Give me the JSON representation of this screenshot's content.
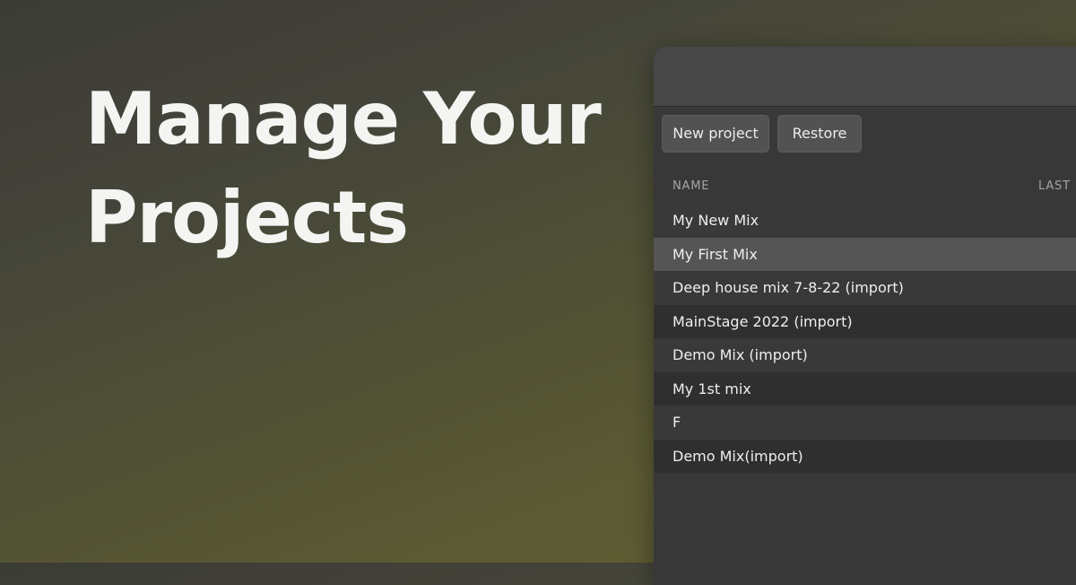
{
  "headline": {
    "line1": "Manage Your",
    "line2": "Projects"
  },
  "window": {
    "toolbar": {
      "new_project_label": "New project",
      "restore_label": "Restore"
    },
    "columns": {
      "name": "NAME",
      "last": "LAST"
    },
    "selected_index": 1,
    "projects": [
      "My New Mix",
      "My First Mix",
      "Deep house mix 7-8-22 (import)",
      "MainStage 2022 (import)",
      "Demo Mix (import)",
      "My 1st mix",
      "F",
      "Demo Mix(import)"
    ]
  }
}
